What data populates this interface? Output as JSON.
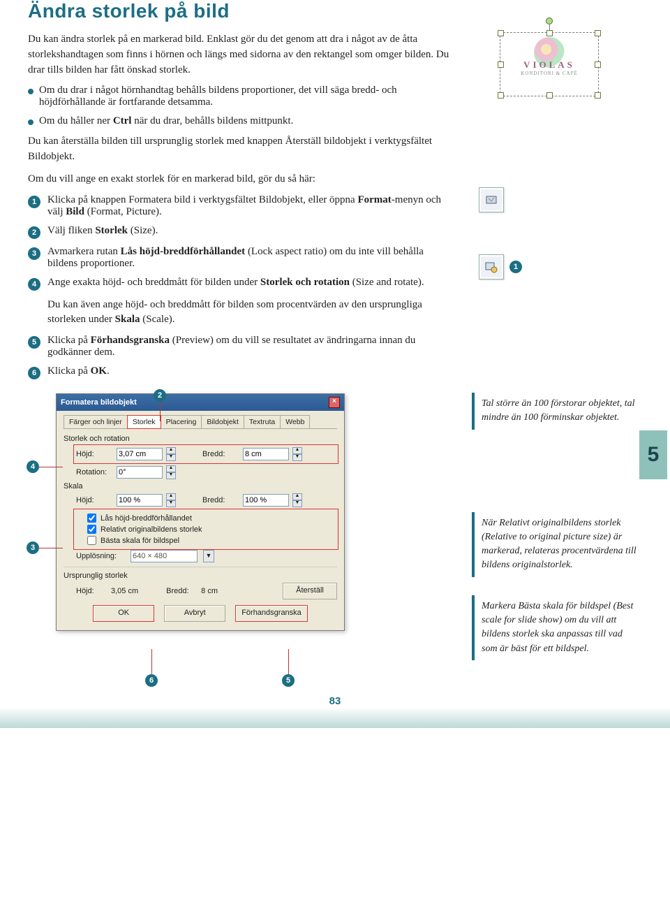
{
  "title": "Ändra storlek på bild",
  "intro": "Du kan ändra storlek på en markerad bild. Enklast gör du det genom att dra i något av de åtta storlekshandtagen som finns i hörnen och längs med sidorna av den rektangel som omger bilden. Du drar tills bilden har fått önskad storlek.",
  "bullets": [
    "Om du drar i något hörnhandtag behålls bildens proportioner, det vill säga bredd- och höjdförhållande är fortfarande detsamma.",
    "Om du håller ner Ctrl när du drar, behålls bildens mittpunkt."
  ],
  "para_restore": "Du kan återställa bilden till ursprunglig storlek med knappen Återställ bildobjekt i verktygsfältet Bildobjekt.",
  "para_exact": "Om du vill ange en exakt storlek för en markerad bild, gör du så här:",
  "steps": [
    "Klicka på knappen Formatera bild i verktygsfältet Bildobjekt, eller öppna Format-menyn och välj Bild (Format, Picture).",
    "Välj fliken Storlek (Size).",
    "Avmarkera rutan Lås höjd-breddförhållandet (Lock aspect ratio) om du inte vill behålla bildens proportioner.",
    "Ange exakta höjd- och breddmått för bilden under Storlek och rotation (Size and rotate)."
  ],
  "para_scale": "Du kan även ange höjd- och breddmått för bilden som procentvärden av den ursprungliga storleken under Skala (Scale).",
  "step5": "Klicka på Förhandsgranska (Preview) om du vill se resultatet av ändringarna innan du godkänner dem.",
  "step6": "Klicka på OK.",
  "tips": [
    "Tal större än 100 förstorar objektet, tal mindre än 100 förminskar objektet.",
    "När Relativt originalbildens storlek (Relative to original picture size) är markerad, relateras procentvärdena till bildens originalstorlek.",
    "Markera Bästa skala för bildspel (Best scale for slide show) om du vill att bildens storlek ska anpassas till vad som är bäst för ett bildspel."
  ],
  "chapter": "5",
  "page_number": "83",
  "side_image": {
    "name": "VIOLAS",
    "sub": "KONDITORI & CAFÉ"
  },
  "dialog": {
    "title": "Formatera bildobjekt",
    "tabs": [
      "Färger och linjer",
      "Storlek",
      "Placering",
      "Bildobjekt",
      "Textruta",
      "Webb"
    ],
    "group_size": "Storlek och rotation",
    "height_label": "Höjd:",
    "width_label": "Bredd:",
    "rotation_label": "Rotation:",
    "height_val": "3,07 cm",
    "width_val": "8 cm",
    "rotation_val": "0°",
    "group_scale": "Skala",
    "scale_h_label": "Höjd:",
    "scale_w_label": "Bredd:",
    "scale_h_val": "100 %",
    "scale_w_val": "100 %",
    "chk_lock": "Lås höjd-breddförhållandet",
    "chk_rel": "Relativt originalbildens storlek",
    "chk_best": "Bästa skala för bildspel",
    "resolution_label": "Upplösning:",
    "resolution_val": "640 × 480",
    "group_orig": "Ursprunglig storlek",
    "orig_h_label": "Höjd:",
    "orig_w_label": "Bredd:",
    "orig_h_val": "3,05 cm",
    "orig_w_val": "8 cm",
    "btn_reset": "Återställ",
    "btn_ok": "OK",
    "btn_cancel": "Avbryt",
    "btn_preview": "Förhandsgranska"
  }
}
